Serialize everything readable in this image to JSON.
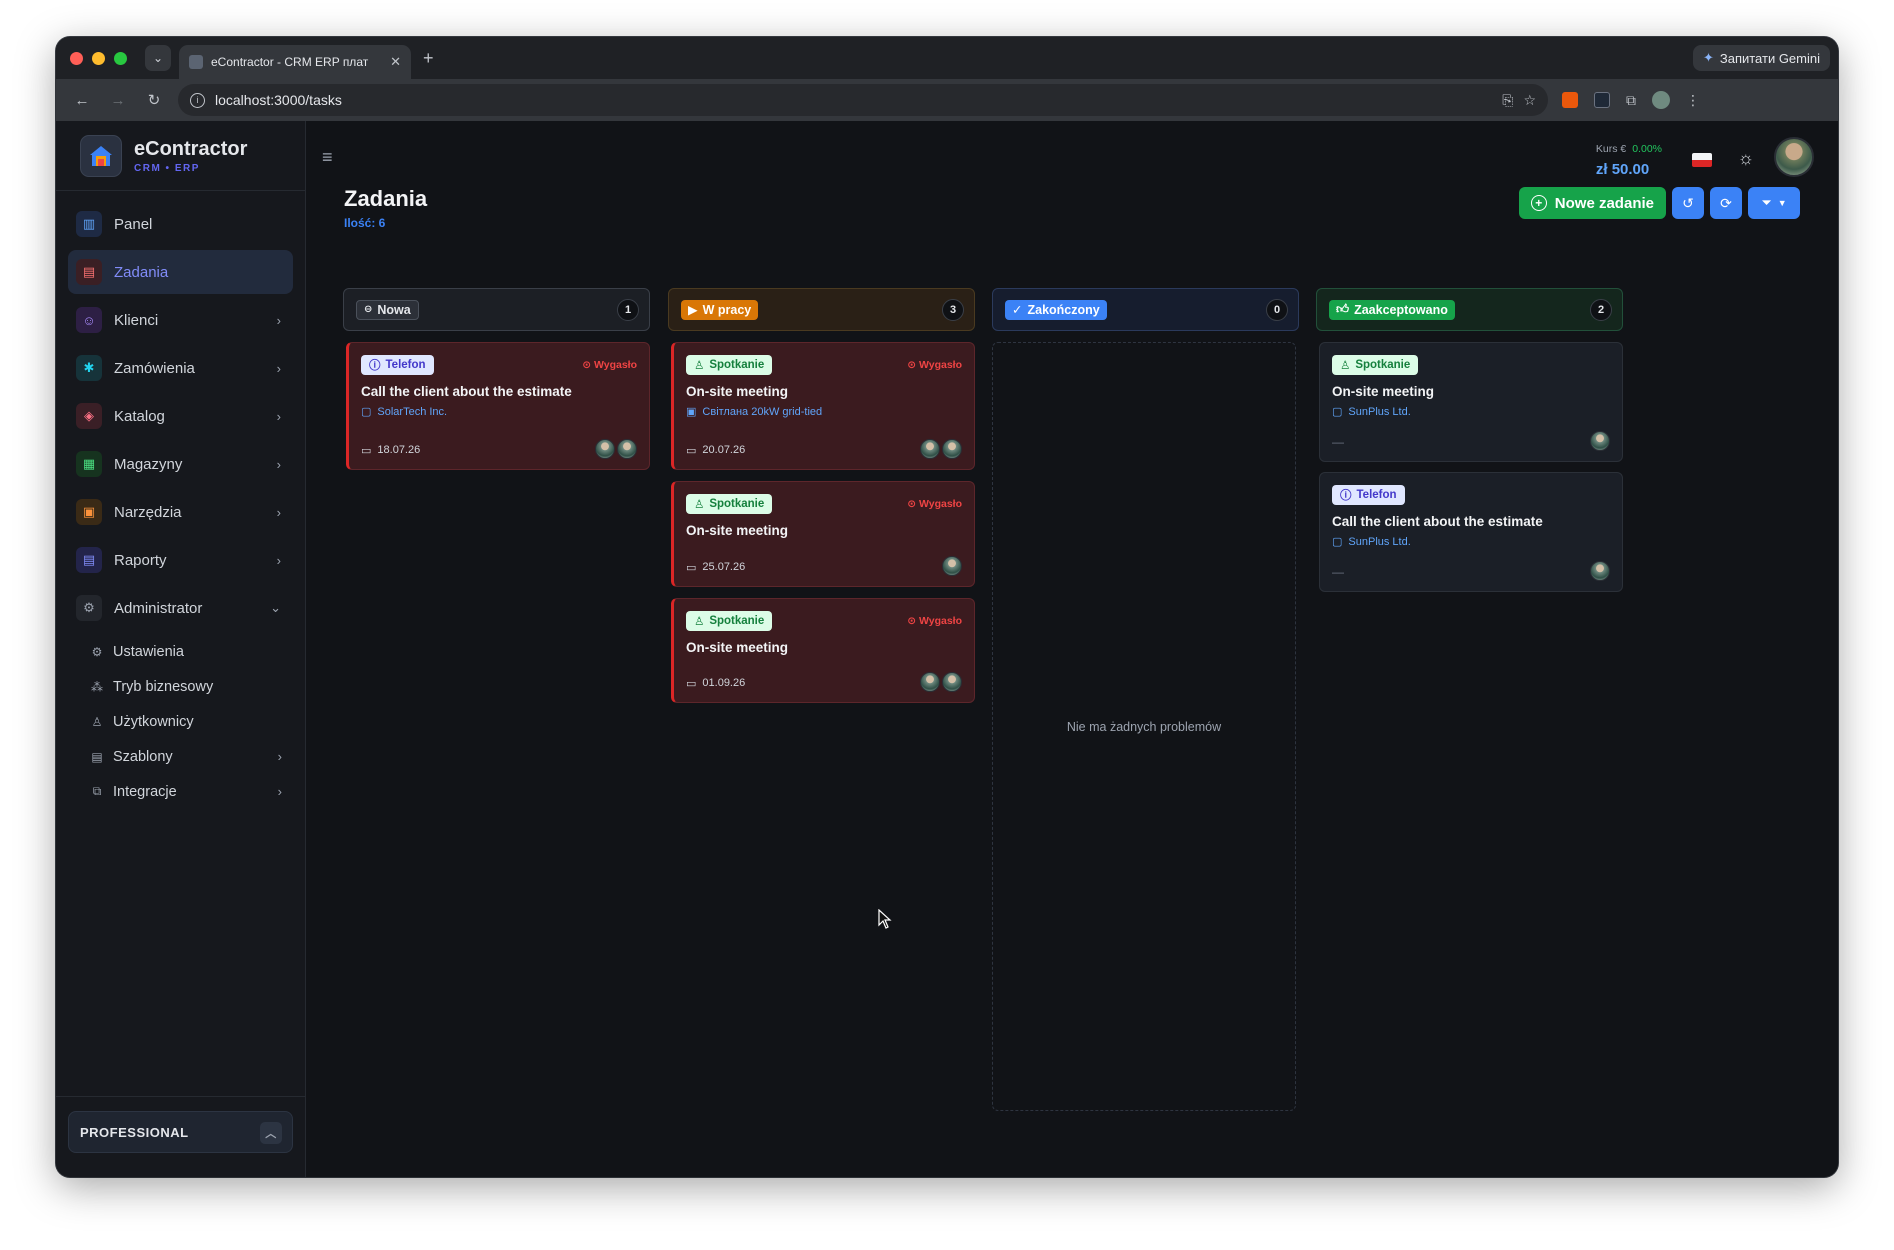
{
  "browser": {
    "tab_title": "eContractor - CRM ERP плат",
    "url": "localhost:3000/tasks",
    "gemini_label": "Запитати Gemini",
    "traffic_colors": [
      "#ff5f57",
      "#febc2e",
      "#28c840"
    ]
  },
  "brand": {
    "name": "eContractor",
    "subtitle": "CRM • ERP"
  },
  "sidebar": {
    "items": [
      {
        "label": "Panel",
        "icon": "chart-bar-icon"
      },
      {
        "label": "Zadania",
        "icon": "clipboard-icon"
      },
      {
        "label": "Klienci",
        "icon": "users-icon"
      },
      {
        "label": "Zamówienia",
        "icon": "cog-order-icon"
      },
      {
        "label": "Katalog",
        "icon": "cube-icon"
      },
      {
        "label": "Magazyny",
        "icon": "warehouse-icon"
      },
      {
        "label": "Narzędzia",
        "icon": "briefcase-icon"
      },
      {
        "label": "Raporty",
        "icon": "document-icon"
      },
      {
        "label": "Administrator",
        "icon": "settings-icon"
      }
    ],
    "admin_sub": [
      {
        "label": "Ustawienia",
        "icon": "gear-icon"
      },
      {
        "label": "Tryb biznesowy",
        "icon": "sliders-icon"
      },
      {
        "label": "Użytkownicy",
        "icon": "user-icon"
      },
      {
        "label": "Szablony",
        "icon": "template-icon"
      },
      {
        "label": "Integracje",
        "icon": "plug-icon"
      }
    ],
    "plan": "PROFESSIONAL"
  },
  "header": {
    "rate_label": "Kurs €",
    "rate_change": "0.00%",
    "rate_amount": "zł 50.00"
  },
  "page": {
    "title": "Zadania",
    "count": "Ilość: 6",
    "new_button": "Nowe zadanie"
  },
  "columns": [
    {
      "name": "Nowa",
      "count": "1"
    },
    {
      "name": "W pracy",
      "count": "3"
    },
    {
      "name": "Zakończony",
      "count": "0",
      "empty": "Nie ma żadnych problemów"
    },
    {
      "name": "Zaakceptowano",
      "count": "2"
    }
  ],
  "cards": {
    "nowa": [
      {
        "tag": "Telefon",
        "status": "Wygasło",
        "title": "Call the client about the estimate",
        "client": "SolarTech Inc.",
        "date": "18.07.26"
      }
    ],
    "w_pracy": [
      {
        "tag": "Spotkanie",
        "status": "Wygasło",
        "title": "On-site meeting",
        "client": "Світлана 20kW grid-tied",
        "date": "20.07.26"
      },
      {
        "tag": "Spotkanie",
        "status": "Wygasło",
        "title": "On-site meeting",
        "date": "25.07.26"
      },
      {
        "tag": "Spotkanie",
        "status": "Wygasło",
        "title": "On-site meeting",
        "date": "01.09.26"
      }
    ],
    "zaakceptowano": [
      {
        "tag": "Spotkanie",
        "title": "On-site meeting",
        "client": "SunPlus Ltd.",
        "date": "—"
      },
      {
        "tag": "Telefon",
        "title": "Call the client about the estimate",
        "client": "SunPlus Ltd.",
        "date": "—"
      }
    ]
  }
}
